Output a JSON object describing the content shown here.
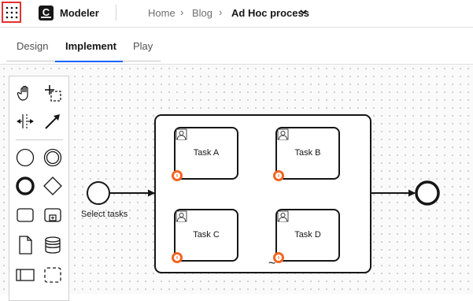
{
  "header": {
    "app_name": "Modeler",
    "logo_letter": "C",
    "breadcrumbs": [
      "Home",
      "Blog"
    ],
    "separator": "›",
    "current": "Ad Hoc process"
  },
  "tabs": [
    {
      "label": "Design",
      "active": false
    },
    {
      "label": "Implement",
      "active": true
    },
    {
      "label": "Play",
      "active": false
    }
  ],
  "palette": {
    "tools": [
      "hand-tool-icon",
      "lasso-tool-icon",
      "space-tool-icon",
      "connect-tool-icon",
      "start-event-icon",
      "intermediate-event-icon",
      "end-event-icon",
      "gateway-icon",
      "task-icon",
      "subprocess-icon",
      "data-object-icon",
      "data-store-icon",
      "pool-icon",
      "group-icon"
    ]
  },
  "diagram": {
    "start_event_label": "Select tasks",
    "tasks": [
      "Task A",
      "Task B",
      "Task C",
      "Task D"
    ],
    "subprocess_marker": "~"
  },
  "colors": {
    "accent": "#0f62fe",
    "apps_border": "#e53030",
    "boundary_event": "#f26522"
  }
}
